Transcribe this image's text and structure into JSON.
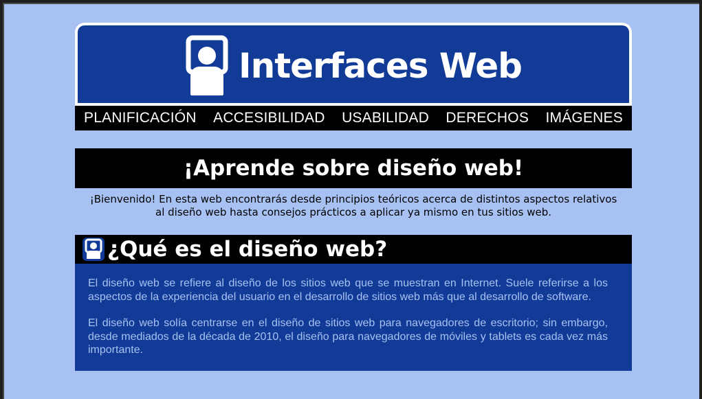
{
  "site": {
    "logo_text": "Interfaces Web",
    "logo_icon": "user-at-monitor-icon"
  },
  "nav": {
    "items": [
      {
        "label": "PLANIFICACIÓN"
      },
      {
        "label": "ACCESIBILIDAD"
      },
      {
        "label": "USABILIDAD"
      },
      {
        "label": "DERECHOS"
      },
      {
        "label": "IMÁGENES"
      }
    ]
  },
  "hero": {
    "title": "¡Aprende sobre diseño web!",
    "intro": "¡Bienvenido! En esta web encontrarás desde principios teóricos acerca de distintos aspectos relativos al diseño web hasta consejos prácticos a aplicar ya mismo en tus sitios web."
  },
  "section": {
    "icon": "user-at-monitor-icon",
    "title": "¿Qué es el diseño web?",
    "paragraphs": [
      "El diseño web se refiere al diseño de los sitios web que se muestran en Internet. Suele referirse a los aspectos de la experiencia del usuario en el desarrollo de sitios web más que al desarrollo de software.",
      "El diseño web solía centrarse en el diseño de sitios web para navegadores de escritorio; sin embargo, desde mediados de la década de 2010, el diseño para navegadores de móviles y tablets es cada vez más importante."
    ]
  },
  "colors": {
    "page_background": "#a7c1f2",
    "brand_blue": "#123b97",
    "bar_black": "#000000",
    "text_white": "#ffffff"
  }
}
